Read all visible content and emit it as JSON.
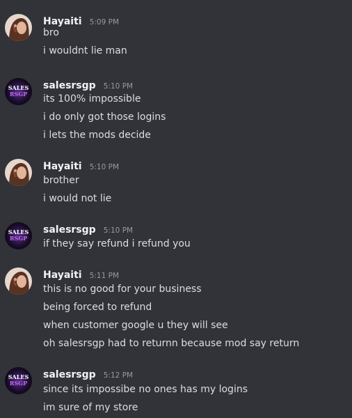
{
  "users": {
    "hayaiti": {
      "name": "Hayaiti",
      "avatar_icon": "woman-portrait-avatar-icon"
    },
    "salesrsgp": {
      "name": "salesrsgp",
      "avatar_icon": "sales-rsgp-logo-avatar-icon",
      "logo_text_top": "SALES",
      "logo_text_bottom": "RSGP"
    }
  },
  "colors": {
    "background": "#313338",
    "username": "#f2f3f5",
    "timestamp": "#949ba4",
    "message_text": "#dbdee1"
  },
  "messages": [
    {
      "author": "Hayaiti",
      "time": "5:09 PM",
      "lines": [
        "bro",
        "i wouldnt lie man"
      ]
    },
    {
      "author": "salesrsgp",
      "time": "5:10 PM",
      "lines": [
        "its 100% impossible",
        "i do only got those logins",
        "i lets the mods decide"
      ]
    },
    {
      "author": "Hayaiti",
      "time": "5:10 PM",
      "lines": [
        "brother",
        "i would not lie"
      ]
    },
    {
      "author": "salesrsgp",
      "time": "5:10 PM",
      "lines": [
        "if they say refund i refund you"
      ]
    },
    {
      "author": "Hayaiti",
      "time": "5:11 PM",
      "lines": [
        "this is no good for your business",
        "being forced to refund",
        "when customer google u they will see",
        "oh salesrsgp had to returnn because mod say return"
      ]
    },
    {
      "author": "salesrsgp",
      "time": "5:12 PM",
      "lines": [
        "since its impossibe no ones has my logins",
        "im sure of my store"
      ]
    }
  ]
}
